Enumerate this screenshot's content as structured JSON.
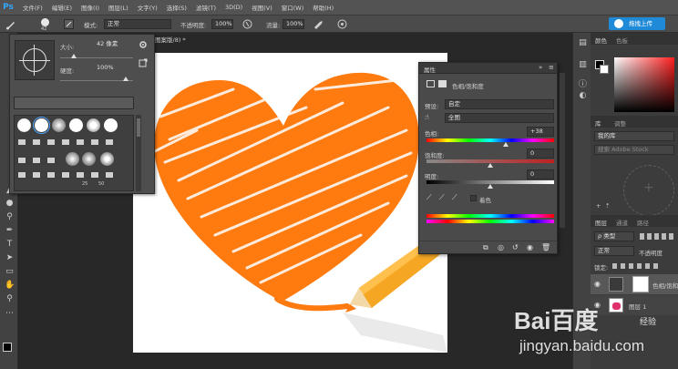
{
  "app": {
    "logo": "Ps"
  },
  "menu": [
    "文件(F)",
    "编辑(E)",
    "图像(I)",
    "图层(L)",
    "文字(Y)",
    "选择(S)",
    "滤镜(T)",
    "3D(D)",
    "视图(V)",
    "窗口(W)",
    "帮助(H)"
  ],
  "options": {
    "brush_size": "42",
    "mode_label": "模式:",
    "mode_value": "正常",
    "opacity_label": "不透明度:",
    "opacity_value": "100%",
    "flow_label": "流量:",
    "flow_value": "100%",
    "share_button": "拖拽上传"
  },
  "document": {
    "tab_title": "图案版/8) *"
  },
  "brush_panel": {
    "size_label": "大小:",
    "size_value": "42 像素",
    "hardness_label": "硬度:",
    "hardness_value": "100%",
    "preset_sizes": [
      "25",
      "50"
    ]
  },
  "properties": {
    "title": "属性",
    "adjustment_title": "色相/饱和度",
    "preset_label": "预设:",
    "preset_value": "自定",
    "channel_value": "全图",
    "hue_label": "色相:",
    "hue_value": "+38",
    "hue_level": 0.62,
    "saturation_label": "饱和度:",
    "saturation_value": "0",
    "saturation_level": 0.5,
    "lightness_label": "明度:",
    "lightness_value": "0",
    "lightness_level": 0.5,
    "colorize_label": "着色"
  },
  "color_panel": {
    "tabs": [
      "颜色",
      "色板"
    ]
  },
  "library_panel": {
    "tabs": [
      "库",
      "调整"
    ],
    "library_name": "我的库",
    "search_placeholder": "搜索 Adobe Stock"
  },
  "layers_panel": {
    "tabs": [
      "图层",
      "通道",
      "路径"
    ],
    "filter_label": "ρ 类型",
    "blend_mode": "正常",
    "opacity_label": "不透明度",
    "lock_label": "锁定:",
    "layers": [
      {
        "name": "色相/饱和度"
      },
      {
        "name": "图层 1"
      }
    ]
  },
  "watermark": {
    "brand": "Bai百度",
    "sub": "经验",
    "url": "jingyan.baidu.com"
  },
  "colors": {
    "accent": "#1f8bd8",
    "heart": "#ff7a0f",
    "pencil": "#f5a623"
  }
}
